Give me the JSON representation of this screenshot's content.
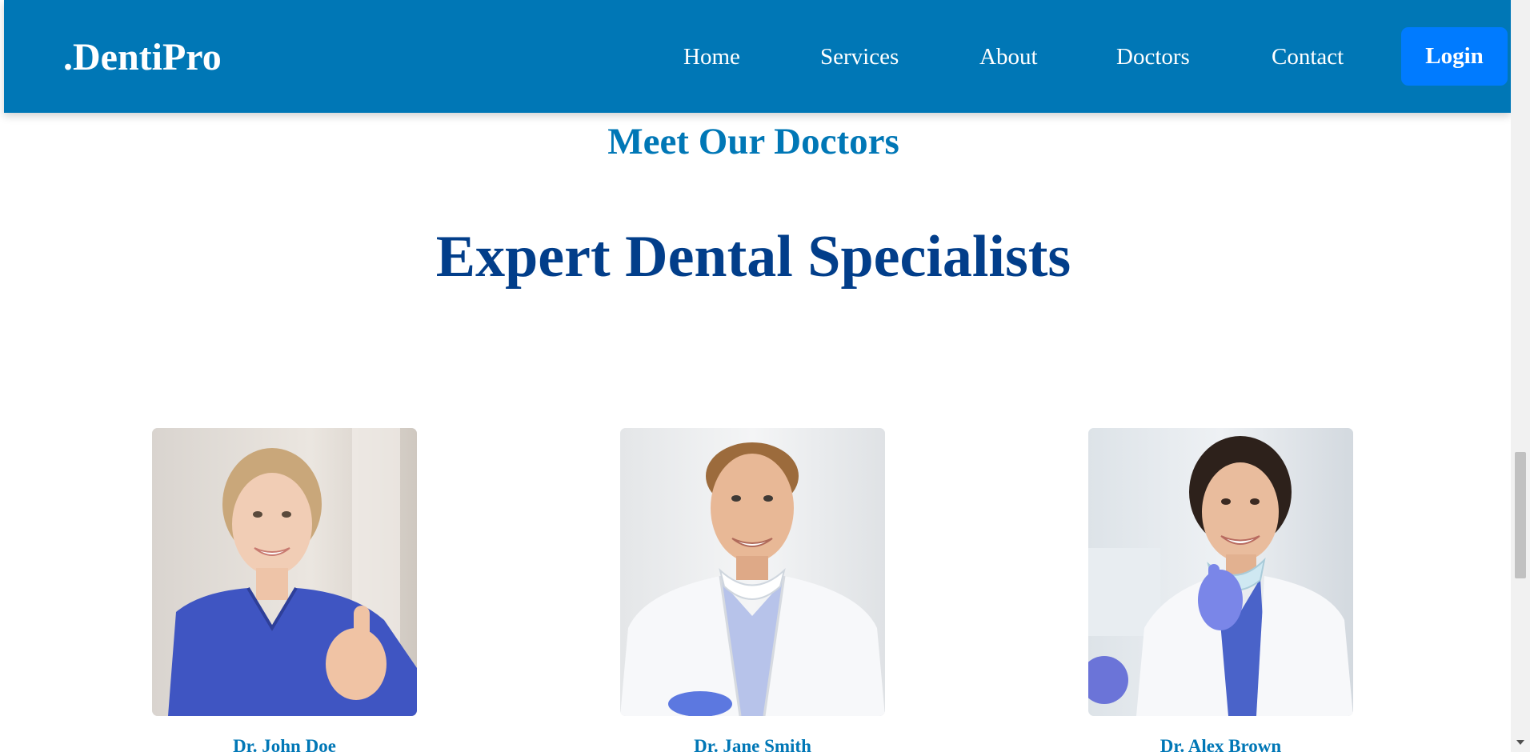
{
  "navbar": {
    "brand": ".DentiPro",
    "links": [
      "Home",
      "Services",
      "About",
      "Doctors",
      "Contact"
    ],
    "login_label": "Login"
  },
  "section": {
    "eyebrow": "Meet Our Doctors",
    "title": "Expert Dental Specialists"
  },
  "doctors": [
    {
      "name": "Dr. John Doe",
      "photo": "female-dentist-thumbs-up-photo"
    },
    {
      "name": "Dr. Jane Smith",
      "photo": "male-dentist-arms-crossed-photo"
    },
    {
      "name": "Dr. Alex Brown",
      "photo": "female-dentist-mask-photo"
    }
  ],
  "colors": {
    "navbar_bg": "#0077b6",
    "login_bg": "#007bff",
    "eyebrow": "#0077b6",
    "title": "#023e8a",
    "doctor_name": "#0077b6"
  }
}
